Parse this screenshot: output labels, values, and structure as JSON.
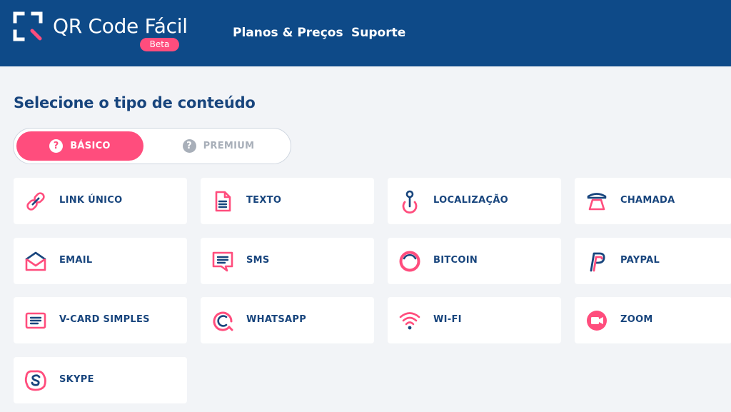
{
  "header": {
    "brand": "QR Code Fácil",
    "badge": "Beta",
    "nav": [
      {
        "label": "Planos & Preços"
      },
      {
        "label": "Suporte"
      }
    ]
  },
  "content": {
    "title": "Selecione o tipo de conteúdo",
    "toggle": {
      "selected": "básico",
      "options": [
        {
          "label": "BÁSICO",
          "icon": "question-icon"
        },
        {
          "label": "PREMIUM",
          "icon": "question-icon"
        }
      ]
    },
    "types": [
      {
        "label": "LINK ÚNICO",
        "icon": "link-icon"
      },
      {
        "label": "TEXTO",
        "icon": "document-icon"
      },
      {
        "label": "LOCALIZAÇÃO",
        "icon": "location-pin-icon"
      },
      {
        "label": "CHAMADA",
        "icon": "phone-icon"
      },
      {
        "label": "EMAIL",
        "icon": "envelope-icon"
      },
      {
        "label": "SMS",
        "icon": "message-icon"
      },
      {
        "label": "BITCOIN",
        "icon": "bitcoin-icon"
      },
      {
        "label": "PAYPAL",
        "icon": "paypal-icon"
      },
      {
        "label": "V-CARD SIMPLES",
        "icon": "vcard-icon"
      },
      {
        "label": "WHATSAPP",
        "icon": "whatsapp-icon"
      },
      {
        "label": "WI-FI",
        "icon": "wifi-icon"
      },
      {
        "label": "ZOOM",
        "icon": "video-camera-icon"
      },
      {
        "label": "SKYPE",
        "icon": "skype-icon"
      }
    ]
  },
  "colors": {
    "header_bg": "#0e4a88",
    "accent": "#ff4d7d",
    "text_dark_blue": "#18457d",
    "page_bg": "#f2f4f7"
  }
}
